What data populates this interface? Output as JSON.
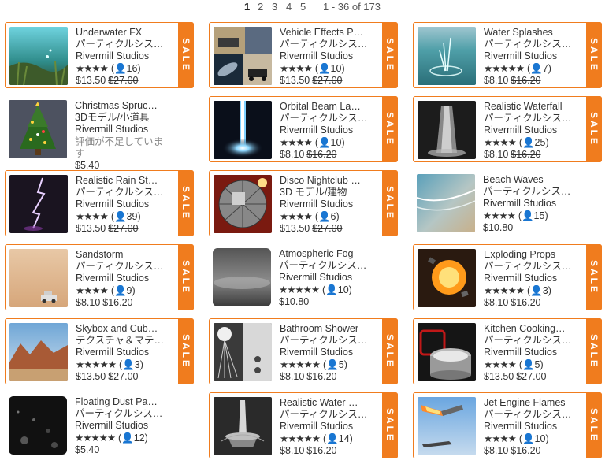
{
  "pagination": {
    "pages": [
      "1",
      "2",
      "3",
      "4",
      "5"
    ],
    "current": "1",
    "range": "1 - 36 of 173"
  },
  "sale_label": "SALE",
  "colors": {
    "sale": "#f07c1e"
  },
  "cards": [
    {
      "title": "Underwater FX",
      "category": "パーティクルシス…",
      "publisher": "Rivermill Studios",
      "stars": "★★★★",
      "reviews": "(👤16)",
      "price": "$13.50",
      "old_price": "$27.00",
      "sale": true
    },
    {
      "title": "Vehicle Effects P…",
      "category": "パーティクルシス…",
      "publisher": "Rivermill Studios",
      "stars": "★★★★",
      "reviews": "(👤10)",
      "price": "$13.50",
      "old_price": "$27.00",
      "sale": true
    },
    {
      "title": "Water Splashes",
      "category": "パーティクルシス…",
      "publisher": "Rivermill Studios",
      "stars": "★★★★★",
      "reviews": "(👤7)",
      "price": "$8.10",
      "old_price": "$16.20",
      "sale": true
    },
    {
      "title": "Christmas Spruc…",
      "category": "3Dモデル/小道具",
      "publisher": "Rivermill Studios",
      "no_reviews": "評価が不足しています",
      "price": "$5.40",
      "sale": false
    },
    {
      "title": "Orbital Beam La…",
      "category": "パーティクルシス…",
      "publisher": "Rivermill Studios",
      "stars": "★★★★",
      "reviews": "(👤10)",
      "price": "$8.10",
      "old_price": "$16.20",
      "sale": true
    },
    {
      "title": "Realistic Waterfall",
      "category": "パーティクルシス…",
      "publisher": "Rivermill Studios",
      "stars": "★★★★",
      "reviews": "(👤25)",
      "price": "$8.10",
      "old_price": "$16.20",
      "sale": true
    },
    {
      "title": "Realistic Rain St…",
      "category": "パーティクルシス…",
      "publisher": "Rivermill Studios",
      "stars": "★★★★",
      "reviews": "(👤39)",
      "price": "$13.50",
      "old_price": "$27.00",
      "sale": true
    },
    {
      "title": "Disco Nightclub …",
      "category": "3D モデル/建物",
      "publisher": "Rivermill Studios",
      "stars": "★★★★",
      "reviews": "(👤6)",
      "price": "$13.50",
      "old_price": "$27.00",
      "sale": true
    },
    {
      "title": "Beach Waves",
      "category": "パーティクルシス…",
      "publisher": "Rivermill Studios",
      "stars": "★★★★",
      "reviews": "(👤15)",
      "price": "$10.80",
      "sale": false
    },
    {
      "title": "Sandstorm",
      "category": "パーティクルシス…",
      "publisher": "Rivermill Studios",
      "stars": "★★★★",
      "reviews": "(👤9)",
      "price": "$8.10",
      "old_price": "$16.20",
      "sale": true
    },
    {
      "title": "Atmospheric Fog",
      "category": "パーティクルシス…",
      "publisher": "Rivermill Studios",
      "stars": "★★★★★",
      "reviews": "(👤10)",
      "price": "$10.80",
      "sale": false
    },
    {
      "title": "Exploding Props",
      "category": "パーティクルシス…",
      "publisher": "Rivermill Studios",
      "stars": "★★★★★",
      "reviews": "(👤3)",
      "price": "$8.10",
      "old_price": "$16.20",
      "sale": true
    },
    {
      "title": "Skybox and Cub…",
      "category": "テクスチャ＆マテ…",
      "publisher": "Rivermill Studios",
      "stars": "★★★★★",
      "reviews": "(👤3)",
      "price": "$13.50",
      "old_price": "$27.00",
      "sale": true
    },
    {
      "title": "Bathroom Shower",
      "category": "パーティクルシス…",
      "publisher": "Rivermill Studios",
      "stars": "★★★★★",
      "reviews": "(👤5)",
      "price": "$8.10",
      "old_price": "$16.20",
      "sale": true
    },
    {
      "title": "Kitchen Cooking…",
      "category": "パーティクルシス…",
      "publisher": "Rivermill Studios",
      "stars": "★★★★",
      "reviews": "(👤5)",
      "price": "$13.50",
      "old_price": "$27.00",
      "sale": true
    },
    {
      "title": "Floating Dust Pa…",
      "category": "パーティクルシス…",
      "publisher": "Rivermill Studios",
      "stars": "★★★★★",
      "reviews": "(👤12)",
      "price": "$5.40",
      "sale": false
    },
    {
      "title": "Realistic Water …",
      "category": "パーティクルシス…",
      "publisher": "Rivermill Studios",
      "stars": "★★★★★",
      "reviews": "(👤14)",
      "price": "$8.10",
      "old_price": "$16.20",
      "sale": true
    },
    {
      "title": "Jet Engine Flames",
      "category": "パーティクルシス…",
      "publisher": "Rivermill Studios",
      "stars": "★★★★",
      "reviews": "(👤10)",
      "price": "$8.10",
      "old_price": "$16.20",
      "sale": true
    }
  ]
}
